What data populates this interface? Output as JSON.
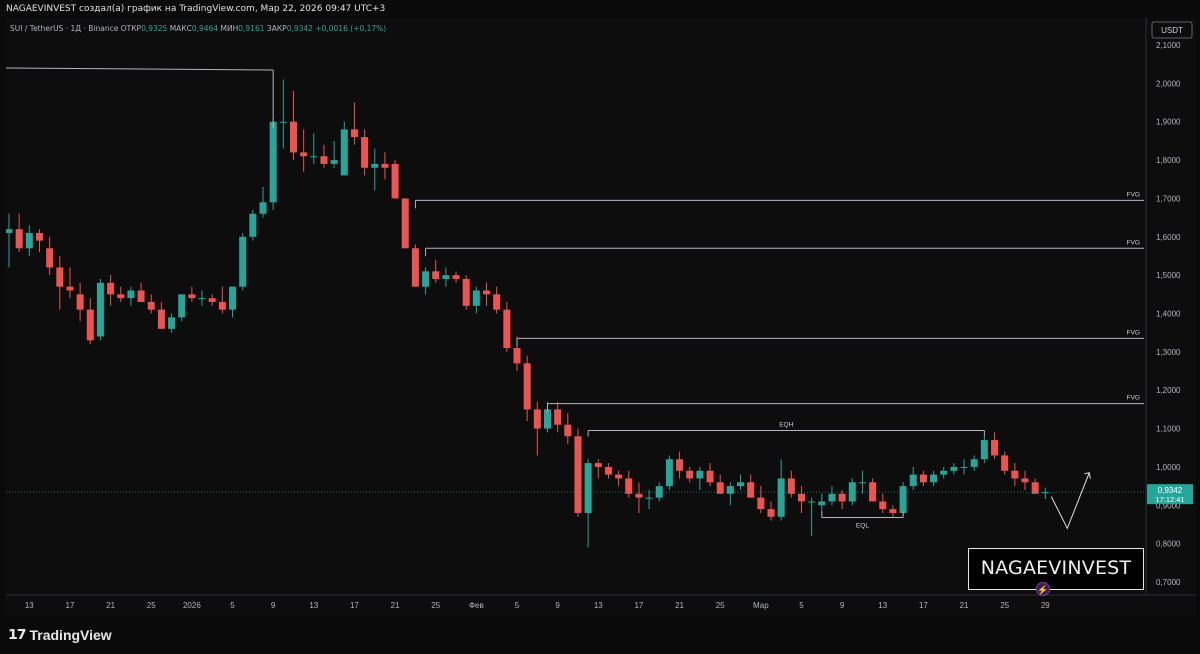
{
  "header": {
    "caption": "NAGAEVINVEST создал(а) график на TradingView.com, Мар 22, 2026 09:47 UTC+3",
    "symbol": "SUI / TetherUS · 1Д · Binance",
    "open_key": "ОТКР",
    "open_val": "0,9325",
    "high_key": "МАКС",
    "high_val": "0,9464",
    "low_key": "МИН",
    "low_val": "0,9161",
    "close_key": "ЗАКР",
    "close_val": "0,9342",
    "change_val": "+0,0016 (+0,17%)"
  },
  "currency_badge": "USDT",
  "footer": {
    "brand": "TradingView"
  },
  "watermark": "NAGAEVINVEST",
  "colors": {
    "up": "#26a69a",
    "down": "#ef5350",
    "background": "#0d0d0d",
    "lines": "#b2b5be",
    "current_price_bg": "#26a69a"
  },
  "chart_data": {
    "type": "candlestick",
    "timeframe": "1D",
    "y_axis": {
      "scale": "linear",
      "range": [
        0.7,
        2.1
      ],
      "currency": "USDT",
      "ticks": [
        "2,1000",
        "2,0000",
        "1,9000",
        "1,8000",
        "1,7000",
        "1,6000",
        "1,5000",
        "1,4000",
        "1,3000",
        "1,2000",
        "1,1000",
        "1,0000",
        "0,9000",
        "0,8000",
        "0,7000"
      ]
    },
    "x_axis": {
      "ticks": [
        "13",
        "17",
        "21",
        "25",
        "2026",
        "5",
        "9",
        "13",
        "17",
        "21",
        "25",
        "Фев",
        "5",
        "9",
        "13",
        "17",
        "21",
        "25",
        "Мар",
        "5",
        "9",
        "13",
        "17",
        "21",
        "25",
        "29"
      ]
    },
    "current_price": {
      "value": "0,9342",
      "countdown": "17:12:41"
    },
    "ohlc": [
      [
        1.61,
        1.66,
        1.52,
        1.62
      ],
      [
        1.62,
        1.66,
        1.56,
        1.57
      ],
      [
        1.57,
        1.63,
        1.55,
        1.61
      ],
      [
        1.61,
        1.62,
        1.56,
        1.59
      ],
      [
        1.57,
        1.6,
        1.5,
        1.52
      ],
      [
        1.52,
        1.55,
        1.41,
        1.47
      ],
      [
        1.47,
        1.52,
        1.44,
        1.46
      ],
      [
        1.45,
        1.48,
        1.38,
        1.41
      ],
      [
        1.41,
        1.44,
        1.32,
        1.33
      ],
      [
        1.34,
        1.49,
        1.33,
        1.48
      ],
      [
        1.48,
        1.5,
        1.42,
        1.45
      ],
      [
        1.45,
        1.47,
        1.43,
        1.44
      ],
      [
        1.44,
        1.47,
        1.42,
        1.46
      ],
      [
        1.46,
        1.48,
        1.43,
        1.43
      ],
      [
        1.43,
        1.45,
        1.4,
        1.41
      ],
      [
        1.41,
        1.43,
        1.36,
        1.36
      ],
      [
        1.36,
        1.4,
        1.35,
        1.39
      ],
      [
        1.39,
        1.45,
        1.38,
        1.45
      ],
      [
        1.45,
        1.47,
        1.43,
        1.44
      ],
      [
        1.44,
        1.46,
        1.42,
        1.44
      ],
      [
        1.44,
        1.45,
        1.42,
        1.43
      ],
      [
        1.43,
        1.47,
        1.4,
        1.41
      ],
      [
        1.41,
        1.47,
        1.39,
        1.47
      ],
      [
        1.47,
        1.61,
        1.46,
        1.6
      ],
      [
        1.6,
        1.67,
        1.59,
        1.66
      ],
      [
        1.66,
        1.73,
        1.65,
        1.69
      ],
      [
        1.69,
        1.91,
        1.67,
        1.9
      ],
      [
        1.9,
        2.01,
        1.83,
        1.9
      ],
      [
        1.9,
        1.98,
        1.8,
        1.82
      ],
      [
        1.82,
        1.88,
        1.77,
        1.81
      ],
      [
        1.81,
        1.87,
        1.79,
        1.81
      ],
      [
        1.81,
        1.84,
        1.78,
        1.79
      ],
      [
        1.79,
        1.85,
        1.78,
        1.8
      ],
      [
        1.76,
        1.9,
        1.76,
        1.88
      ],
      [
        1.88,
        1.95,
        1.84,
        1.86
      ],
      [
        1.86,
        1.88,
        1.76,
        1.78
      ],
      [
        1.78,
        1.83,
        1.72,
        1.79
      ],
      [
        1.79,
        1.82,
        1.75,
        1.78
      ],
      [
        1.79,
        1.8,
        1.71,
        1.7
      ],
      [
        1.7,
        1.7,
        1.57,
        1.57
      ],
      [
        1.57,
        1.58,
        1.47,
        1.47
      ],
      [
        1.47,
        1.52,
        1.45,
        1.51
      ],
      [
        1.51,
        1.54,
        1.48,
        1.49
      ],
      [
        1.49,
        1.52,
        1.47,
        1.5
      ],
      [
        1.5,
        1.51,
        1.48,
        1.49
      ],
      [
        1.49,
        1.5,
        1.41,
        1.42
      ],
      [
        1.42,
        1.47,
        1.4,
        1.46
      ],
      [
        1.46,
        1.48,
        1.42,
        1.45
      ],
      [
        1.45,
        1.47,
        1.4,
        1.41
      ],
      [
        1.41,
        1.43,
        1.3,
        1.31
      ],
      [
        1.31,
        1.34,
        1.25,
        1.27
      ],
      [
        1.27,
        1.29,
        1.12,
        1.15
      ],
      [
        1.15,
        1.17,
        1.03,
        1.1
      ],
      [
        1.1,
        1.17,
        1.09,
        1.15
      ],
      [
        1.15,
        1.17,
        1.09,
        1.11
      ],
      [
        1.11,
        1.14,
        1.06,
        1.08
      ],
      [
        1.08,
        1.1,
        0.87,
        0.88
      ],
      [
        0.88,
        1.02,
        0.79,
        1.01
      ],
      [
        1.01,
        1.02,
        0.97,
        1.0
      ],
      [
        1.0,
        1.01,
        0.97,
        0.98
      ],
      [
        0.98,
        0.99,
        0.95,
        0.97
      ],
      [
        0.97,
        0.99,
        0.92,
        0.93
      ],
      [
        0.93,
        0.96,
        0.88,
        0.92
      ],
      [
        0.92,
        0.94,
        0.89,
        0.92
      ],
      [
        0.92,
        0.96,
        0.91,
        0.95
      ],
      [
        0.95,
        1.03,
        0.94,
        1.02
      ],
      [
        1.02,
        1.04,
        0.97,
        0.99
      ],
      [
        0.99,
        1.0,
        0.96,
        0.97
      ],
      [
        0.97,
        1.0,
        0.94,
        0.99
      ],
      [
        0.99,
        1.01,
        0.95,
        0.96
      ],
      [
        0.96,
        0.98,
        0.93,
        0.93
      ],
      [
        0.93,
        0.96,
        0.9,
        0.95
      ],
      [
        0.95,
        0.98,
        0.94,
        0.96
      ],
      [
        0.96,
        0.98,
        0.92,
        0.92
      ],
      [
        0.92,
        0.95,
        0.88,
        0.89
      ],
      [
        0.89,
        0.91,
        0.86,
        0.87
      ],
      [
        0.87,
        1.02,
        0.86,
        0.97
      ],
      [
        0.97,
        0.99,
        0.92,
        0.93
      ],
      [
        0.93,
        0.95,
        0.88,
        0.91
      ],
      [
        0.91,
        0.92,
        0.82,
        0.91
      ],
      [
        0.9,
        0.93,
        0.88,
        0.91
      ],
      [
        0.91,
        0.95,
        0.9,
        0.93
      ],
      [
        0.93,
        0.94,
        0.89,
        0.91
      ],
      [
        0.91,
        0.97,
        0.9,
        0.96
      ],
      [
        0.96,
        0.99,
        0.93,
        0.96
      ],
      [
        0.96,
        0.97,
        0.91,
        0.91
      ],
      [
        0.91,
        0.93,
        0.88,
        0.89
      ],
      [
        0.89,
        0.9,
        0.87,
        0.88
      ],
      [
        0.88,
        0.96,
        0.87,
        0.95
      ],
      [
        0.95,
        1.0,
        0.94,
        0.98
      ],
      [
        0.98,
        0.99,
        0.95,
        0.96
      ],
      [
        0.96,
        0.99,
        0.95,
        0.98
      ],
      [
        0.98,
        1.0,
        0.97,
        0.99
      ],
      [
        0.99,
        1.01,
        0.98,
        1.0
      ],
      [
        1.0,
        1.02,
        0.98,
        1.0
      ],
      [
        1.0,
        1.03,
        0.99,
        1.02
      ],
      [
        1.02,
        1.08,
        1.01,
        1.07
      ],
      [
        1.07,
        1.09,
        1.02,
        1.03
      ],
      [
        1.03,
        1.04,
        0.98,
        0.99
      ],
      [
        0.99,
        1.01,
        0.95,
        0.97
      ],
      [
        0.97,
        0.99,
        0.94,
        0.96
      ],
      [
        0.96,
        0.97,
        0.93,
        0.93
      ],
      [
        0.9325,
        0.9464,
        0.9161,
        0.9342
      ]
    ],
    "annotations": [
      {
        "label": "",
        "type": "hline",
        "price": 2.04
      },
      {
        "label": "FVG",
        "type": "zone_line",
        "price": 1.695
      },
      {
        "label": "FVG",
        "type": "zone_line",
        "price": 1.57
      },
      {
        "label": "FVG",
        "type": "zone_line",
        "price": 1.335
      },
      {
        "label": "FVG",
        "type": "zone_line",
        "price": 1.165
      },
      {
        "label": "EQH",
        "type": "range_line",
        "price": 1.095
      },
      {
        "label": "EQL",
        "type": "range_line",
        "price": 0.868
      }
    ],
    "projection": {
      "type": "arrow",
      "from_price": 0.933,
      "low_price": 0.84,
      "to_price": 0.985
    }
  }
}
